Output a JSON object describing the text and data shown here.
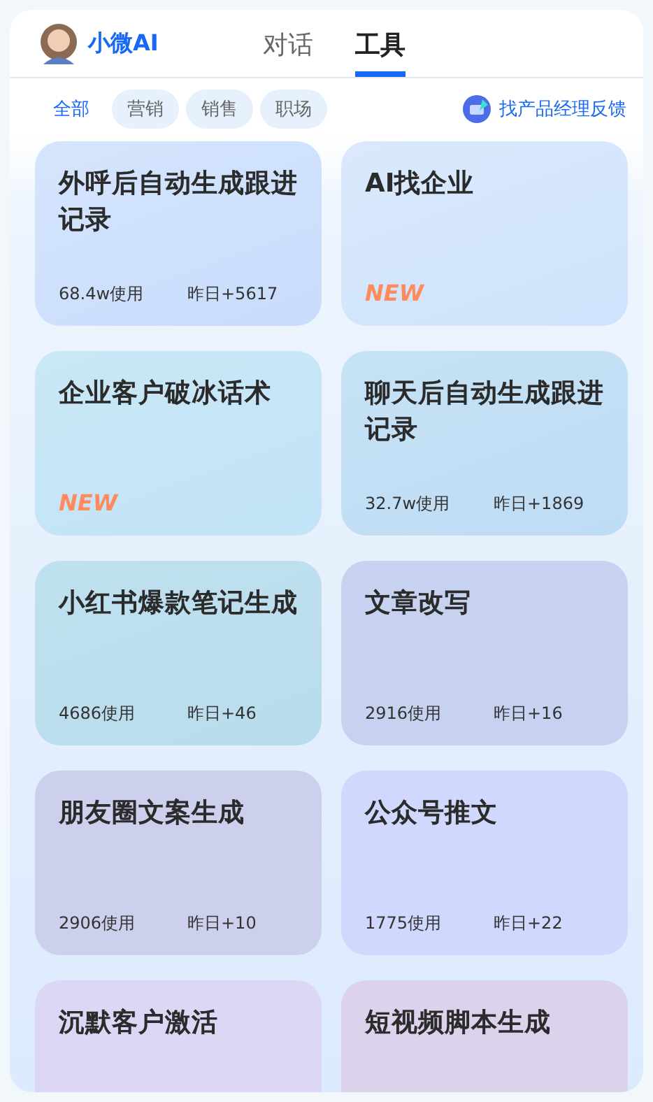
{
  "brand": {
    "name": "小微AI"
  },
  "tabs": [
    {
      "label": "对话",
      "selected": false
    },
    {
      "label": "工具",
      "selected": true
    }
  ],
  "filters": [
    {
      "label": "全部",
      "selected": true
    },
    {
      "label": "营销",
      "selected": false
    },
    {
      "label": "销售",
      "selected": false
    },
    {
      "label": "职场",
      "selected": false
    }
  ],
  "feedback": {
    "label": "找产品经理反馈"
  },
  "cards": [
    {
      "kind": "stats",
      "title": "外呼后自动生成跟进记录",
      "usage": "68.4w使用",
      "yesterday": "昨日+5617"
    },
    {
      "kind": "new",
      "title": "AI找企业",
      "badge": "NEW"
    },
    {
      "kind": "new",
      "title": "企业客户破冰话术",
      "badge": "NEW"
    },
    {
      "kind": "stats",
      "title": "聊天后自动生成跟进记录",
      "usage": "32.7w使用",
      "yesterday": "昨日+1869"
    },
    {
      "kind": "stats",
      "title": "小红书爆款笔记生成",
      "usage": "4686使用",
      "yesterday": "昨日+46"
    },
    {
      "kind": "stats",
      "title": "文章改写",
      "usage": "2916使用",
      "yesterday": "昨日+16"
    },
    {
      "kind": "stats",
      "title": "朋友圈文案生成",
      "usage": "2906使用",
      "yesterday": "昨日+10"
    },
    {
      "kind": "stats",
      "title": "公众号推文",
      "usage": "1775使用",
      "yesterday": "昨日+22"
    },
    {
      "kind": "cut",
      "title": "沉默客户激活"
    },
    {
      "kind": "cut",
      "title": "短视频脚本生成"
    }
  ]
}
